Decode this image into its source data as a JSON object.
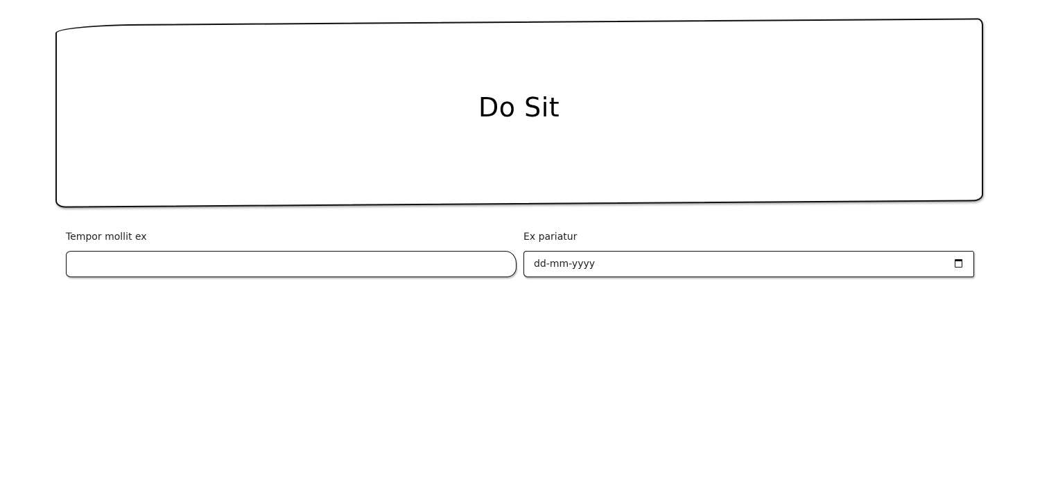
{
  "header": {
    "title": "Do Sit"
  },
  "form": {
    "text_field": {
      "label": "Tempor mollit ex",
      "value": "",
      "placeholder": ""
    },
    "date_field": {
      "label": "Ex pariatur",
      "placeholder_text": "dd-mm-yyyy",
      "icon": "calendar-icon"
    }
  },
  "colors": {
    "border": "#111111",
    "background": "#ffffff"
  }
}
